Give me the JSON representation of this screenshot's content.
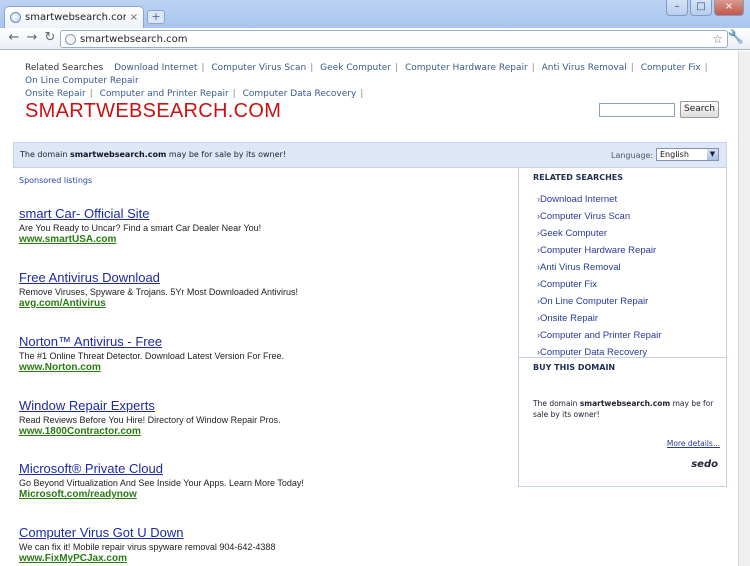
{
  "browser": {
    "tab_title": "smartwebsearch.com - smart",
    "tab_close": "×",
    "new_tab": "+",
    "address": "smartwebsearch.com",
    "window_buttons": [
      "–",
      "□",
      "×"
    ]
  },
  "page": {
    "related_label": "Related Searches",
    "related_links": [
      "Download Internet",
      "Computer Virus Scan",
      "Geek Computer",
      "Computer Hardware Repair",
      "Anti Virus Removal",
      "Computer Fix",
      "On Line Computer Repair",
      "Onsite Repair",
      "Computer and Printer Repair",
      "Computer Data Recovery"
    ],
    "site_title": "SMARTWEBSEARCH.COM",
    "search_button": "Search",
    "sale_bar": {
      "prefix": "The domain",
      "domain": "smartwebsearch.com",
      "suffix": "may be for sale by its owner!",
      "language_label": "Language:",
      "language_value": "English"
    },
    "sponsored_label": "Sponsored listings",
    "ads": [
      {
        "title": "smart Car- Official Site",
        "desc": "Are You Ready to Uncar? Find a smart Car Dealer Near You!",
        "url": "www.smartUSA.com"
      },
      {
        "title": "Free Antivirus Download",
        "desc": "Remove Viruses, Spyware & Trojans. 5Yr Most Downloaded Antivirus!",
        "url": "avg.com/Antivirus"
      },
      {
        "title": "Norton™ Antivirus - Free",
        "desc": "The #1 Online Threat Detector. Download Latest Version For Free.",
        "url": "www.Norton.com"
      },
      {
        "title": "Window Repair Experts",
        "desc": "Read Reviews Before You Hire! Directory of Window Repair Pros.",
        "url": "www.1800Contractor.com"
      },
      {
        "title": "Microsoft® Private Cloud",
        "desc": "Go Beyond Virtualization And See Inside Your Apps. Learn More Today!",
        "url": "Microsoft.com/readynow"
      },
      {
        "title": "Computer Virus Got U Down",
        "desc": "We can fix it! Mobile repair virus spyware removal 904-642-4388",
        "url": "www.FixMyPCJax.com"
      }
    ],
    "sidebar": {
      "related_heading": "RELATED SEARCHES",
      "buy_heading": "BUY THIS DOMAIN",
      "buy_prefix": "The domain",
      "buy_domain": "smartwebsearch.com",
      "buy_suffix": "may be for sale by its owner!",
      "more_details": "More details...",
      "brand": "sedo"
    }
  }
}
